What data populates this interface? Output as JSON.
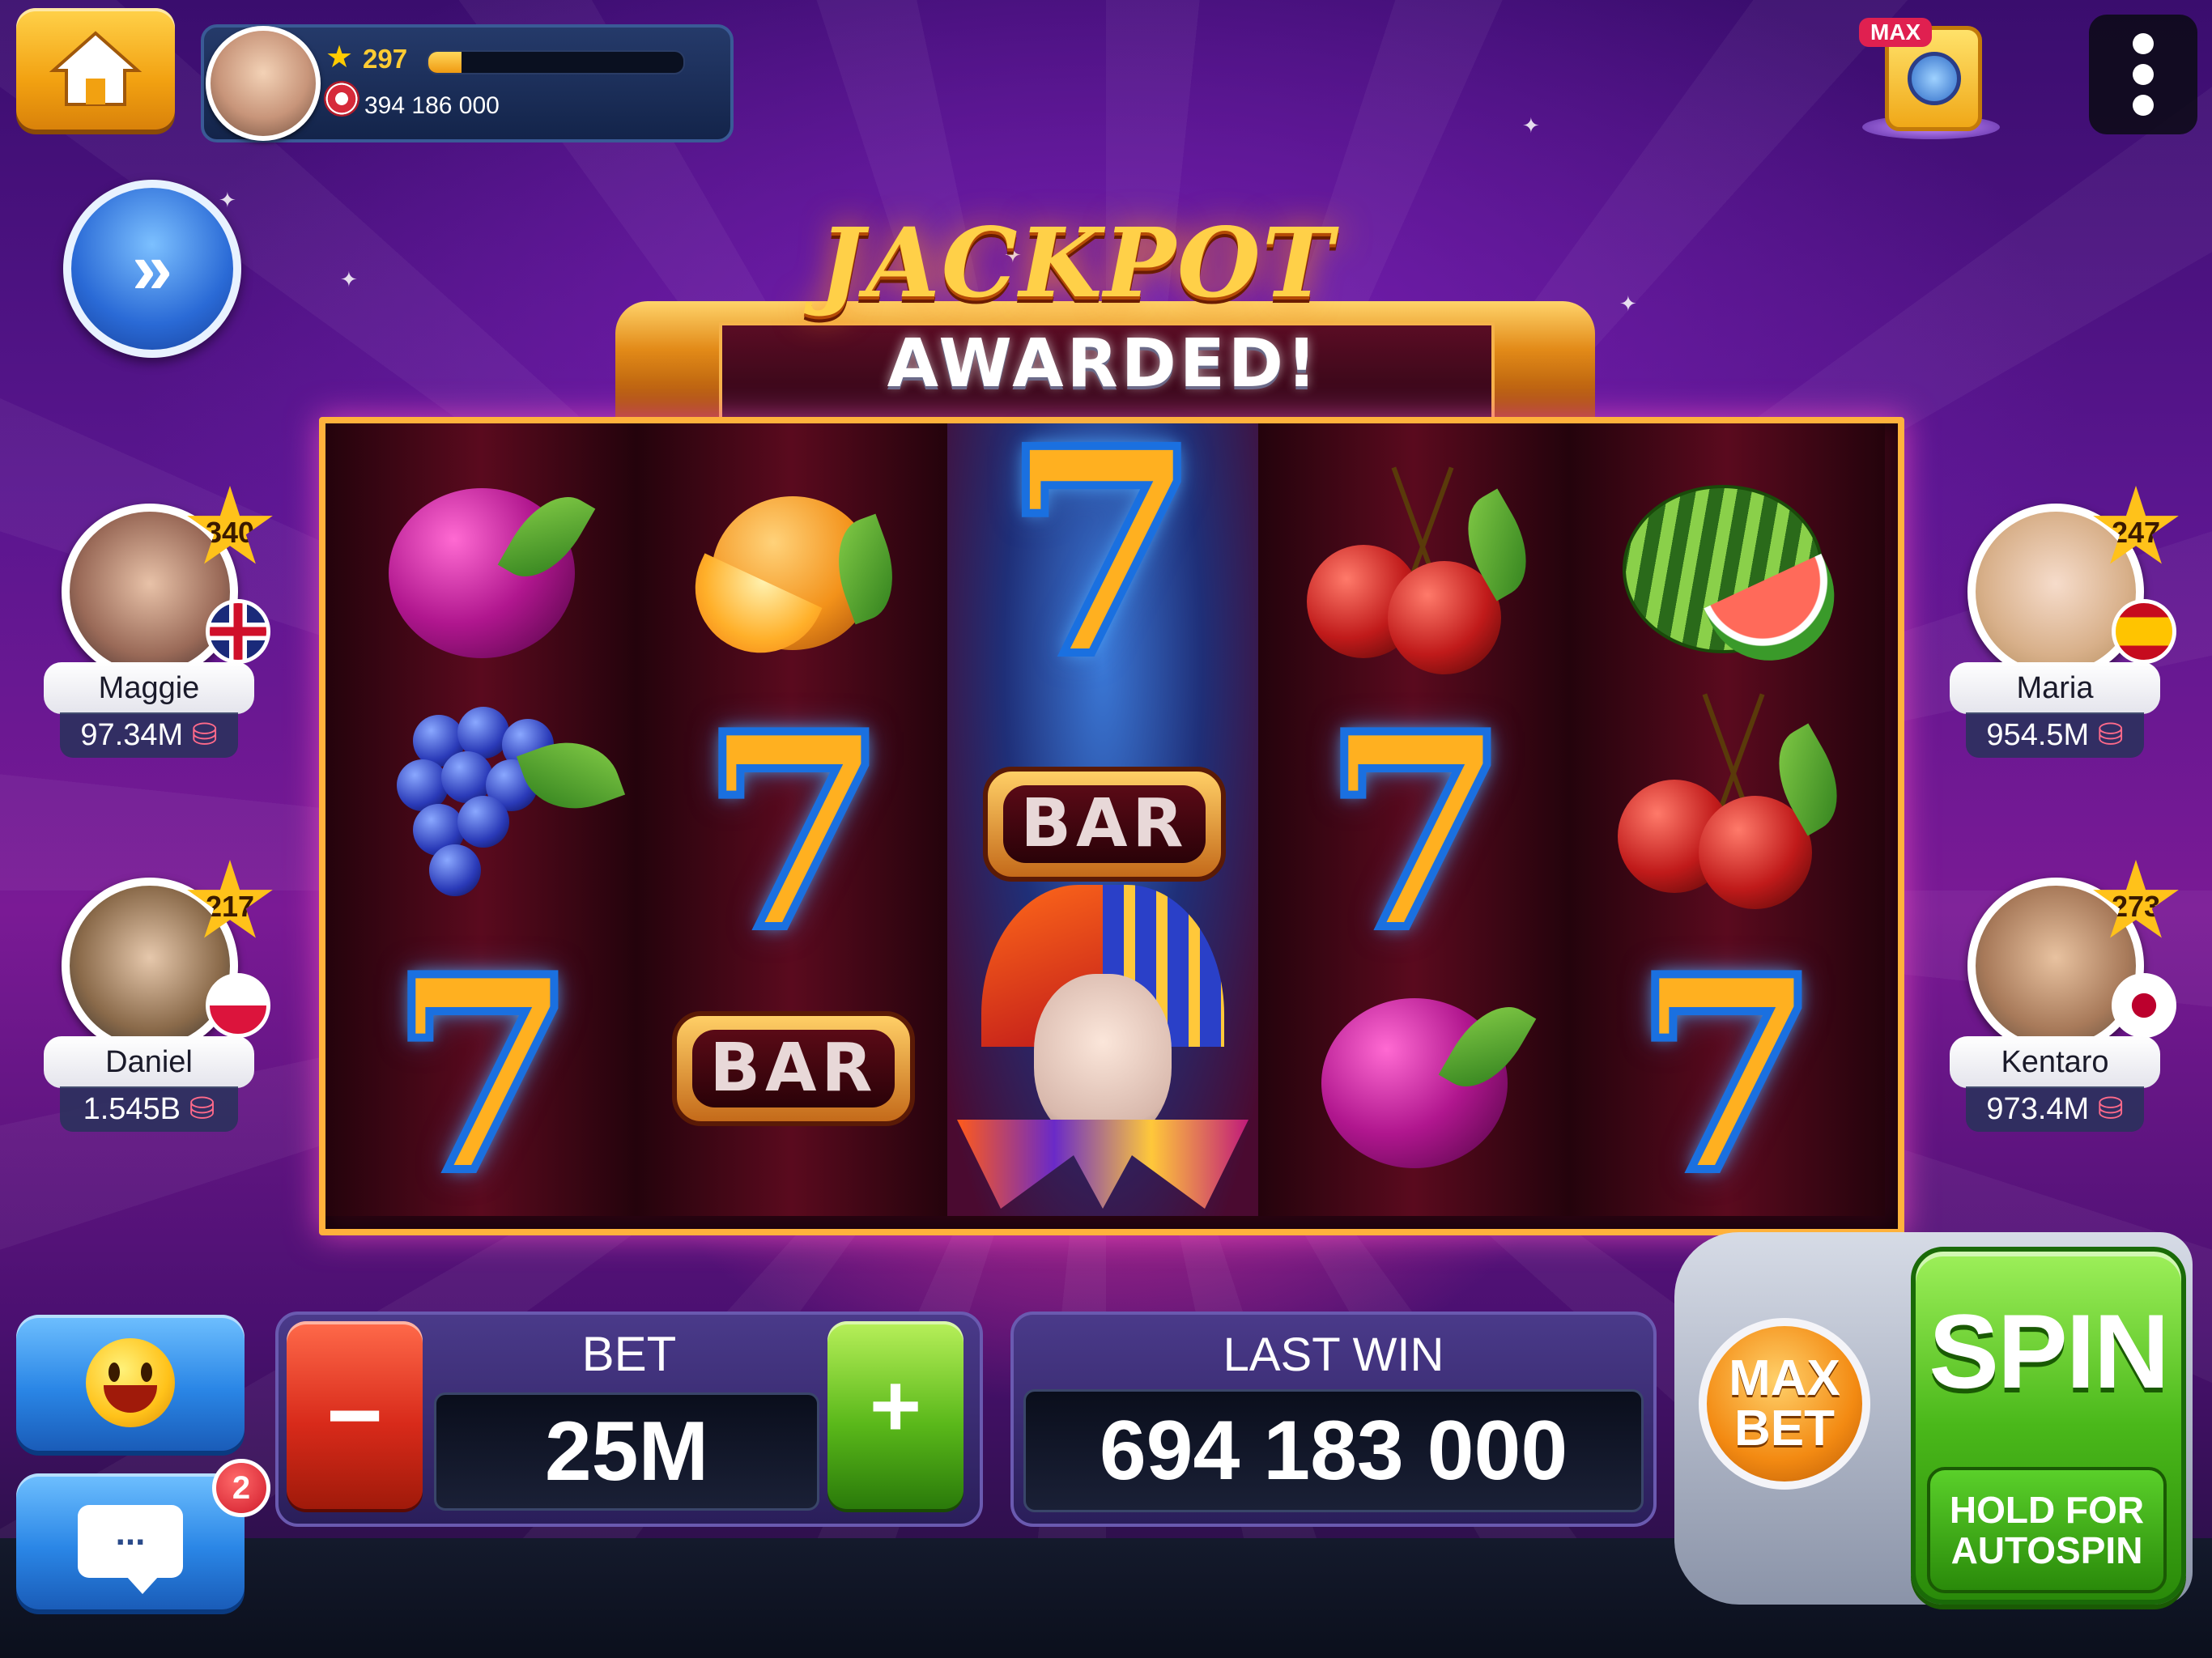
{
  "header": {
    "level": "297",
    "xp_progress": 0.13,
    "coins": "394 186 000"
  },
  "vault": {
    "badge": "MAX"
  },
  "banner": {
    "title": "JACKPOT",
    "subtitle": "AWARDED!"
  },
  "reels": {
    "bar_label": "BAR",
    "seven_label": "7"
  },
  "players": [
    {
      "name": "Maggie",
      "level": "340",
      "coins": "97.34M",
      "flag": "UK"
    },
    {
      "name": "Daniel",
      "level": "217",
      "coins": "1.545B",
      "flag": "Poland"
    },
    {
      "name": "Maria",
      "level": "247",
      "coins": "954.5M",
      "flag": "Spain"
    },
    {
      "name": "Kentaro",
      "level": "273",
      "coins": "973.4M",
      "flag": "Japan"
    }
  ],
  "controls": {
    "chat_badge": "2",
    "bet_label": "BET",
    "bet_value": "25M",
    "minus_label": "−",
    "plus_label": "+",
    "last_win_label": "LAST WIN",
    "last_win_value": "694 183 000",
    "max_bet_line1": "MAX",
    "max_bet_line2": "BET",
    "spin_label": "SPIN",
    "hold_line1": "HOLD FOR",
    "hold_line2": "AUTOSPIN"
  },
  "icons": {
    "home": "home-icon",
    "forward": "fast-forward-icon",
    "menu": "more-vertical-icon",
    "emoji": "smiley-icon",
    "chat": "chat-bubble-icon",
    "chip": "casino-chip-icon",
    "star": "star-icon"
  },
  "colors": {
    "accent_gold": "#ffb23c",
    "spin_green": "#4ab81a",
    "minus_red": "#d82a1a",
    "maxbet_orange": "#f38a12"
  }
}
